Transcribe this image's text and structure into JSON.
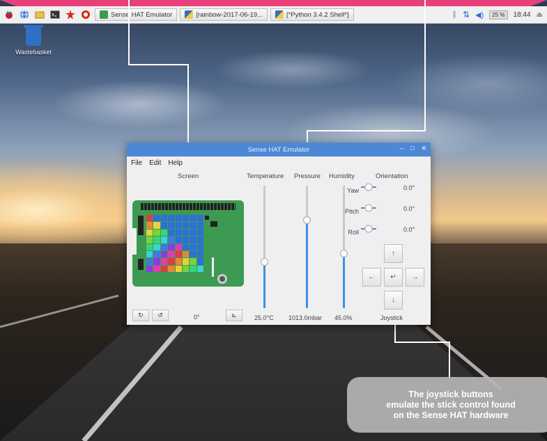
{
  "taskbar": {
    "tasks": [
      {
        "label": "Sense HAT Emulator"
      },
      {
        "label": "[rainbow-2017-06-19..."
      },
      {
        "label": "[*Python 3.4.2 Shell*]"
      }
    ],
    "badge": "25 %",
    "clock": "18:44"
  },
  "desktop": {
    "trash_label": "Wastebasket"
  },
  "window": {
    "title": "Sense HAT Emulator",
    "menu": [
      "File",
      "Edit",
      "Help"
    ],
    "screen_label": "Screen",
    "temperature_label": "Temperature",
    "pressure_label": "Pressure",
    "humidity_label": "Humidity",
    "orientation_label": "Orientation",
    "joystick_label": "Joystick",
    "rotation_value": "0°",
    "temperature_value": "25.0°C",
    "pressure_value": "1013.0mbar",
    "humidity_value": "45.0%",
    "temperature_level": 0.38,
    "pressure_level": 0.72,
    "humidity_level": 0.45,
    "orientation": [
      {
        "label": "Yaw",
        "value": "0.0°"
      },
      {
        "label": "Pitch",
        "value": "0.0°"
      },
      {
        "label": "Roll",
        "value": "0.0°"
      }
    ],
    "rotate_cw_icon": "rotate-cw-icon",
    "rotate_ccw_icon": "rotate-ccw-icon",
    "flip_icon": "flip-icon",
    "joystick_icons": {
      "up": "↑",
      "down": "↓",
      "left": "←",
      "right": "→",
      "enter": "↵"
    }
  },
  "callout": {
    "line1": "The joystick buttons",
    "line2": "emulate the stick control found",
    "line3": "on the Sense HAT hardware"
  },
  "colors": {
    "accent": "#e8407a",
    "titlebar": "#4c88d6",
    "slider_fill": "#3d8fe6",
    "board": "#3d9a52"
  }
}
